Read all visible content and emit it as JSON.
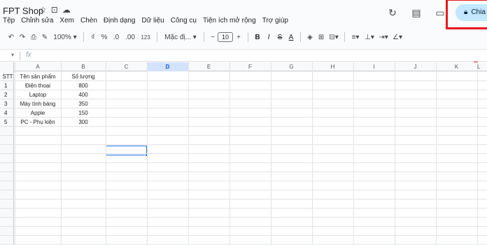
{
  "app": {
    "title": "FPT Shop",
    "share_label": "Chia"
  },
  "menu": [
    "Tệp",
    "Chỉnh sửa",
    "Xem",
    "Chèn",
    "Định dạng",
    "Dữ liệu",
    "Công cụ",
    "Tiện ích mở rộng",
    "Trợ giúp"
  ],
  "toolbar": {
    "zoom": "100%",
    "currency": "₫",
    "percent": "%",
    "dec_decrease": ".0",
    "dec_increase": ".00",
    "number_format": "123",
    "font": "Mặc đị...",
    "font_size": "10",
    "bold": "B",
    "italic": "I",
    "strike": "S",
    "text_color": "A"
  },
  "formula_bar": {
    "fx": "fx"
  },
  "columns": [
    "A",
    "B",
    "C",
    "D",
    "E",
    "F",
    "G",
    "H",
    "I",
    "J",
    "K",
    "L"
  ],
  "selected_column": "D",
  "table": {
    "headers": [
      "STT",
      "Tên sản phẩm",
      "Số lượng"
    ],
    "rows": [
      [
        "1",
        "Điện thoại",
        "800"
      ],
      [
        "2",
        "Laptop",
        "400"
      ],
      [
        "3",
        "Máy tính bảng",
        "350"
      ],
      [
        "4",
        "Apple",
        "150"
      ],
      [
        "5",
        "PC - Phụ kiện",
        "300"
      ]
    ]
  },
  "colors": {
    "accent": "#1a73e8",
    "share_bg": "#c2e7ff",
    "annotation": "#e51a1a"
  },
  "icons": [
    "star-icon",
    "move-folder-icon",
    "cloud-status-icon",
    "history-icon",
    "comment-icon",
    "video-call-icon",
    "lock-icon",
    "undo-icon",
    "redo-icon",
    "print-icon",
    "paint-format-icon"
  ]
}
